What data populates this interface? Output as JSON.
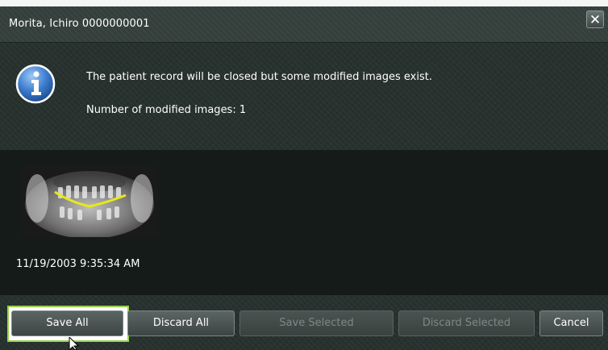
{
  "window": {
    "title": "Morita, Ichiro  0000000001",
    "close_label": "✕"
  },
  "message": {
    "line1": "The patient record will be closed but some modified images exist.",
    "line2": "Number of modified images: 1"
  },
  "images": [
    {
      "timestamp": "11/19/2003 9:35:34 AM",
      "type": "panoramic-xray"
    }
  ],
  "buttons": {
    "save_all": "Save All",
    "discard_all": "Discard All",
    "save_selected": "Save Selected",
    "discard_selected": "Discard Selected",
    "cancel": "Cancel"
  },
  "colors": {
    "dialog_bg": "#27312e",
    "accent_focus": "#9ad24a",
    "xray_curve": "#e8e81a"
  },
  "icons": [
    "info-icon",
    "close-icon",
    "mouse-pointer-icon"
  ]
}
